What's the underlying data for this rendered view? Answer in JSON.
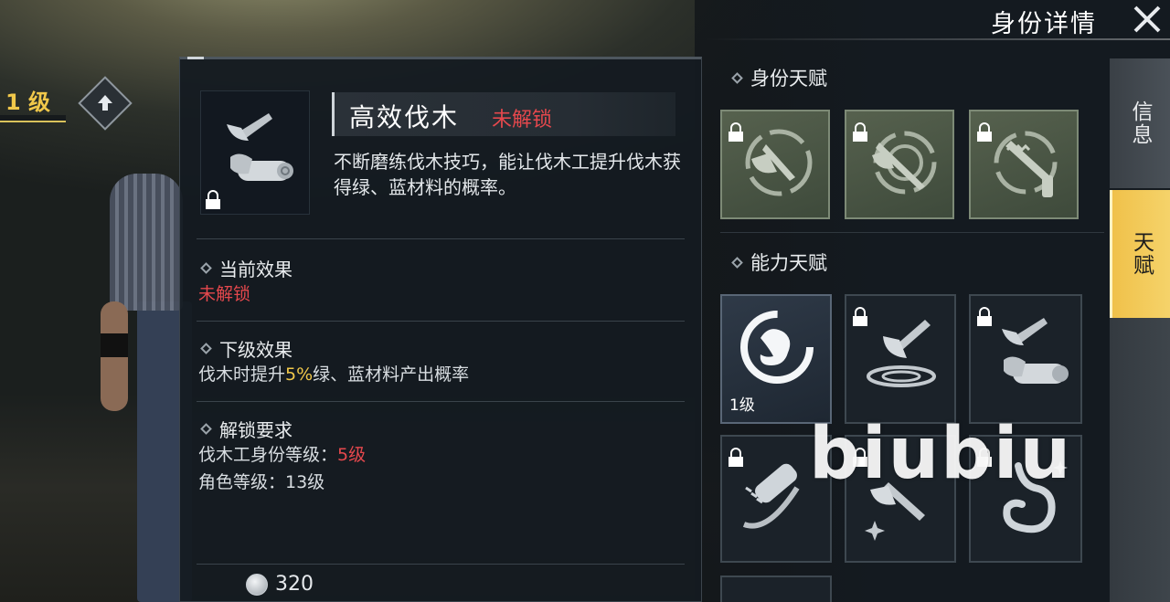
{
  "header": {
    "title": "身份详情"
  },
  "player": {
    "level_label": "1 级"
  },
  "skill": {
    "name": "高效伐木",
    "status": "未解锁",
    "description": "不断磨练伐木技巧，能让伐木工提升伐木获得绿、蓝材料的概率。"
  },
  "current_effect": {
    "heading": "当前效果",
    "value": "未解锁"
  },
  "next_effect": {
    "heading": "下级效果",
    "prefix": "伐木时提升",
    "highlight": "5%",
    "suffix": "绿、蓝材料产出概率"
  },
  "unlock_requirements": {
    "heading": "解锁要求",
    "req1_label": "伐木工身份等级：",
    "req1_value": "5级",
    "req2": "角色等级：13级"
  },
  "cost": {
    "amount": "320"
  },
  "identity_talents": {
    "heading": "身份天赋",
    "slots": [
      {
        "icon": "axe-circle-icon",
        "locked": true
      },
      {
        "icon": "axe-crossed-icon",
        "locked": true
      },
      {
        "icon": "saw-circle-icon",
        "locked": true
      }
    ]
  },
  "ability_talents": {
    "heading": "能力天赋",
    "slots": [
      {
        "icon": "strength-arm-icon",
        "level": "1级",
        "locked": false
      },
      {
        "icon": "axe-impact-icon",
        "locked": true
      },
      {
        "icon": "axe-log-icon",
        "locked": true
      },
      {
        "icon": "chainsaw-icon",
        "locked": true
      },
      {
        "icon": "axe-sparkle-icon",
        "locked": true
      },
      {
        "icon": "stomach-icon",
        "locked": true
      }
    ]
  },
  "tabs": [
    {
      "label": "信息",
      "active": false
    },
    {
      "label": "天赋",
      "active": true
    }
  ],
  "watermark": "biubiu",
  "colors": {
    "accent": "#f1c84a",
    "locked_red": "#e5484d"
  }
}
